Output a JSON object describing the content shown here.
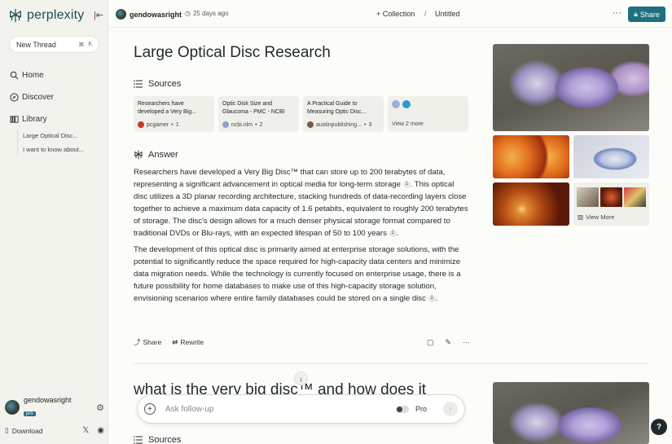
{
  "app": {
    "name": "perplexity"
  },
  "sidebar": {
    "new_thread": "New Thread",
    "shortcut_cmd": "⌘",
    "shortcut_key": "K",
    "nav": [
      {
        "label": "Home",
        "icon": "search-icon"
      },
      {
        "label": "Discover",
        "icon": "compass-icon"
      },
      {
        "label": "Library",
        "icon": "library-icon"
      }
    ],
    "library_items": [
      "Large Optical Disc...",
      "I want to know about..."
    ],
    "user": {
      "name": "gendowasright",
      "badge": "pro"
    },
    "download": "Download"
  },
  "topbar": {
    "author": "gendowasright",
    "ago": "25 days ago",
    "collection": "+ Collection",
    "separator": "/",
    "untitled": "Untitled",
    "share": "Share"
  },
  "thread": {
    "title": "Large Optical Disc Research",
    "sources_heading": "Sources",
    "sources": [
      {
        "title": "Researchers have developed a Very Big...",
        "site": "pcgamer",
        "num": "1",
        "color": "#c0392b"
      },
      {
        "title": "Optic Disk Size and Glaucoma - PMC - NCBI",
        "site": "ncbi.nlm",
        "num": "2",
        "color": "#8fa3c8"
      },
      {
        "title": "A Practical Guide to Measuring Optic Disc...",
        "site": "austinpublishing...",
        "num": "3",
        "color": "#7a5a4a"
      }
    ],
    "view_more_sources": "View 2 more",
    "answer_heading": "Answer",
    "p1a": "Researchers have developed a Very Big Disc™ that can store up to 200 terabytes of data, representing a significant advancement in optical media for long-term storage",
    "p1b": ". This optical disc utilizes a 3D planar recording architecture, stacking hundreds of data-recording layers close together to achieve a maximum data capacity of 1.6 petabits, equivalent to roughly 200 terabytes of storage. The disc's design allows for a much denser physical storage format compared to traditional DVDs or Blu-rays, with an expected lifespan of 50 to 100 years",
    "p1c": ".",
    "p2a": "The development of this optical disc is primarily aimed at enterprise storage solutions, with the potential to significantly reduce the space required for high-capacity data centers and minimize data migration needs. While the technology is currently focused on enterprise usage, there is a future possibility for home databases to make use of this high-capacity storage solution, envisioning scenarios where entire family databases could be stored on a single disc",
    "p2b": ".",
    "cite": "1",
    "share": "Share",
    "rewrite": "Rewrite",
    "next_question": "what is the very big disc™ and how does it",
    "next_sources": "Sources",
    "images_view_more": "View More"
  },
  "followup": {
    "placeholder": "Ask follow-up",
    "pro": "Pro"
  },
  "help": "?",
  "colors": {
    "accent": "#1f6f80",
    "background": "#fcfcf9",
    "sidebar": "#f3f3ee"
  }
}
